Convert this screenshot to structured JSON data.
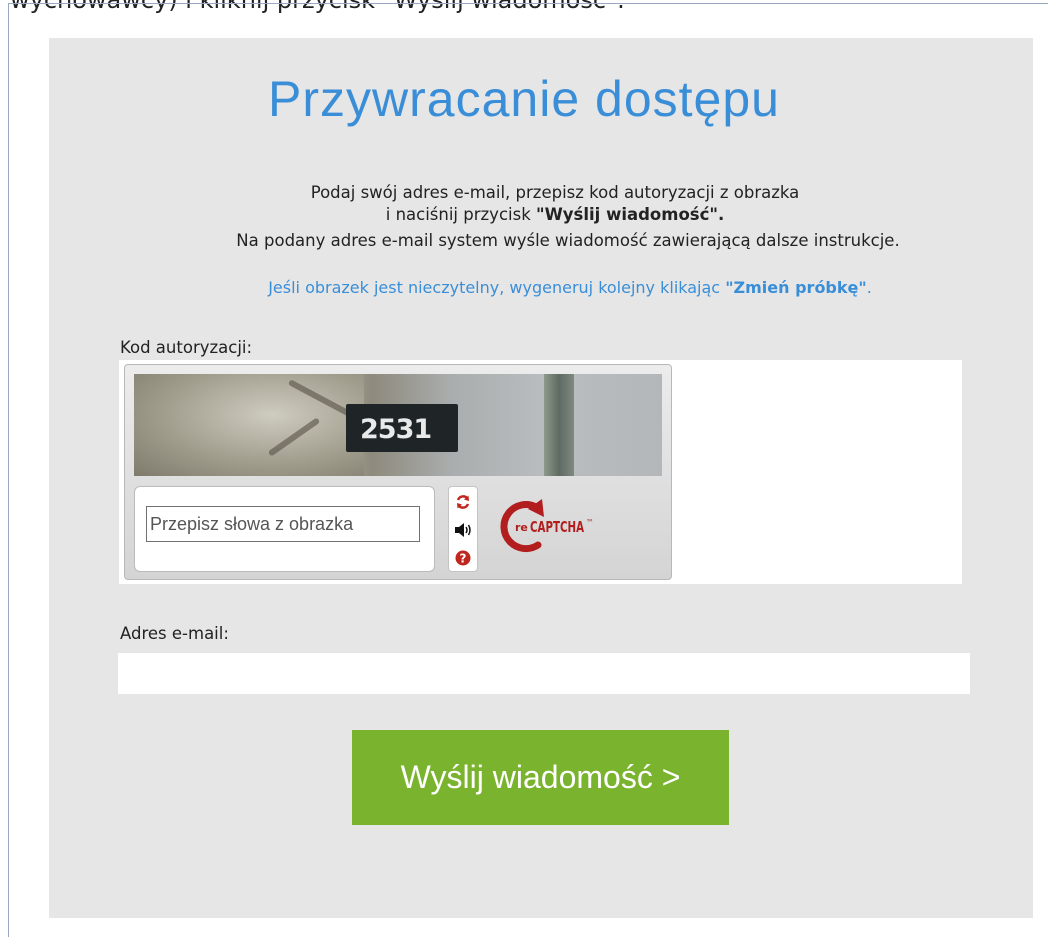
{
  "top_text": "wychowawcy) i kliknij przycisk \"Wyślij wiadomość\".",
  "title": "Przywracanie dostępu",
  "instructions": {
    "line1": "Podaj swój adres e-mail, przepisz kod autoryzacji z obrazka",
    "line2_prefix": "i naciśnij przycisk ",
    "line2_bold": "\"Wyślij wiadomość\".",
    "line3": "Na podany adres e-mail system wyśle wiadomość zawierającą dalsze instrukcje."
  },
  "hint": {
    "prefix": "Jeśli obrazek jest nieczytelny, wygeneruj kolejny klikając ",
    "bold": "\"Zmień próbkę\"",
    "suffix": "."
  },
  "captcha": {
    "label": "Kod autoryzacji:",
    "image_text": "2531",
    "input_placeholder": "Przepisz słowa z obrazka",
    "input_value": "",
    "logo_prefix": "re",
    "logo_text": "CAPTCHA",
    "logo_tm": "™",
    "icons": [
      "refresh-icon",
      "audio-icon",
      "help-icon"
    ]
  },
  "email": {
    "label": "Adres e-mail:",
    "value": ""
  },
  "submit_label": "Wyślij wiadomość >",
  "colors": {
    "accent_blue": "#3a8ed8",
    "button_green": "#7ab32e",
    "panel_bg": "#e6e6e6",
    "recaptcha_red": "#b21d1d"
  }
}
